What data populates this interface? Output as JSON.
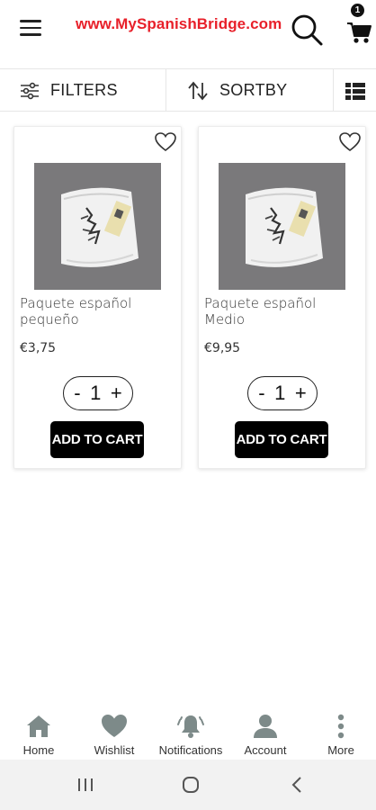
{
  "header": {
    "title": "www.MySpanishBridge.com",
    "title_color": "#e8202a",
    "menu_icon": "hamburger-icon",
    "search_icon": "search-icon",
    "cart_icon": "cart-icon",
    "cart_count": "1"
  },
  "toolbar": {
    "filters_label": "FILTERS",
    "filters_icon": "sliders-icon",
    "sortby_label": "SORTBY",
    "sortby_icon": "sort-arrows-icon",
    "layout_icon": "list-view-icon"
  },
  "products": [
    {
      "name": "Paquete español pequeño",
      "price": "€3,75",
      "quantity": "1",
      "add_label": "ADD TO CART"
    },
    {
      "name": "Paquete español Medio",
      "price": "€9,95",
      "quantity": "1",
      "add_label": "ADD TO CART"
    }
  ],
  "qty_controls": {
    "minus": "-",
    "plus": "+"
  },
  "bottom_nav": [
    {
      "label": "Home",
      "icon": "home-icon"
    },
    {
      "label": "Wishlist",
      "icon": "heart-icon"
    },
    {
      "label": "Notifications",
      "icon": "bell-icon"
    },
    {
      "label": "Account",
      "icon": "person-icon"
    },
    {
      "label": "More",
      "icon": "more-vertical-icon"
    }
  ],
  "colors": {
    "accent": "#e8202a",
    "nav_icon": "#7d8a89",
    "button": "#000000"
  }
}
